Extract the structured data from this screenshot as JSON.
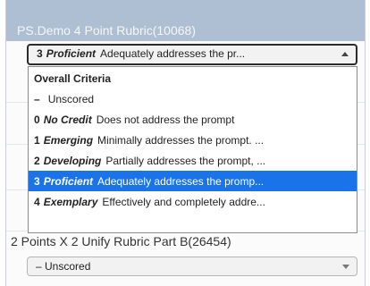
{
  "rubric_1": {
    "title": "PS.Demo 4 Point Rubric(10068)",
    "selected": {
      "number": "3",
      "level": "Proficient",
      "description": "Adequately addresses the pr..."
    },
    "dropdown": {
      "group_label": "Overall Criteria",
      "items": [
        {
          "number": "–",
          "level": "",
          "description": "Unscored"
        },
        {
          "number": "0",
          "level": "No Credit",
          "description": "Does not address the prompt"
        },
        {
          "number": "1",
          "level": "Emerging",
          "description": "Minimally addresses the prompt. ..."
        },
        {
          "number": "2",
          "level": "Developing",
          "description": "Partially addresses the prompt, ..."
        },
        {
          "number": "3",
          "level": "Proficient",
          "description": "Adequately addresses the promp..."
        },
        {
          "number": "4",
          "level": "Exemplary",
          "description": "Effectively and completely addre..."
        }
      ]
    }
  },
  "rubric_2": {
    "title": "2 Points X 2 Unify Rubric Part B(26454)",
    "selected_value": "–  Unscored"
  },
  "colors": {
    "header_bg": "#aebfd3",
    "selected_item_bg": "#1a73e8",
    "select_border_active": "#2b2b2b"
  },
  "icons": {
    "open_select": "chevron-up-icon",
    "closed_select": "chevron-down-icon"
  }
}
